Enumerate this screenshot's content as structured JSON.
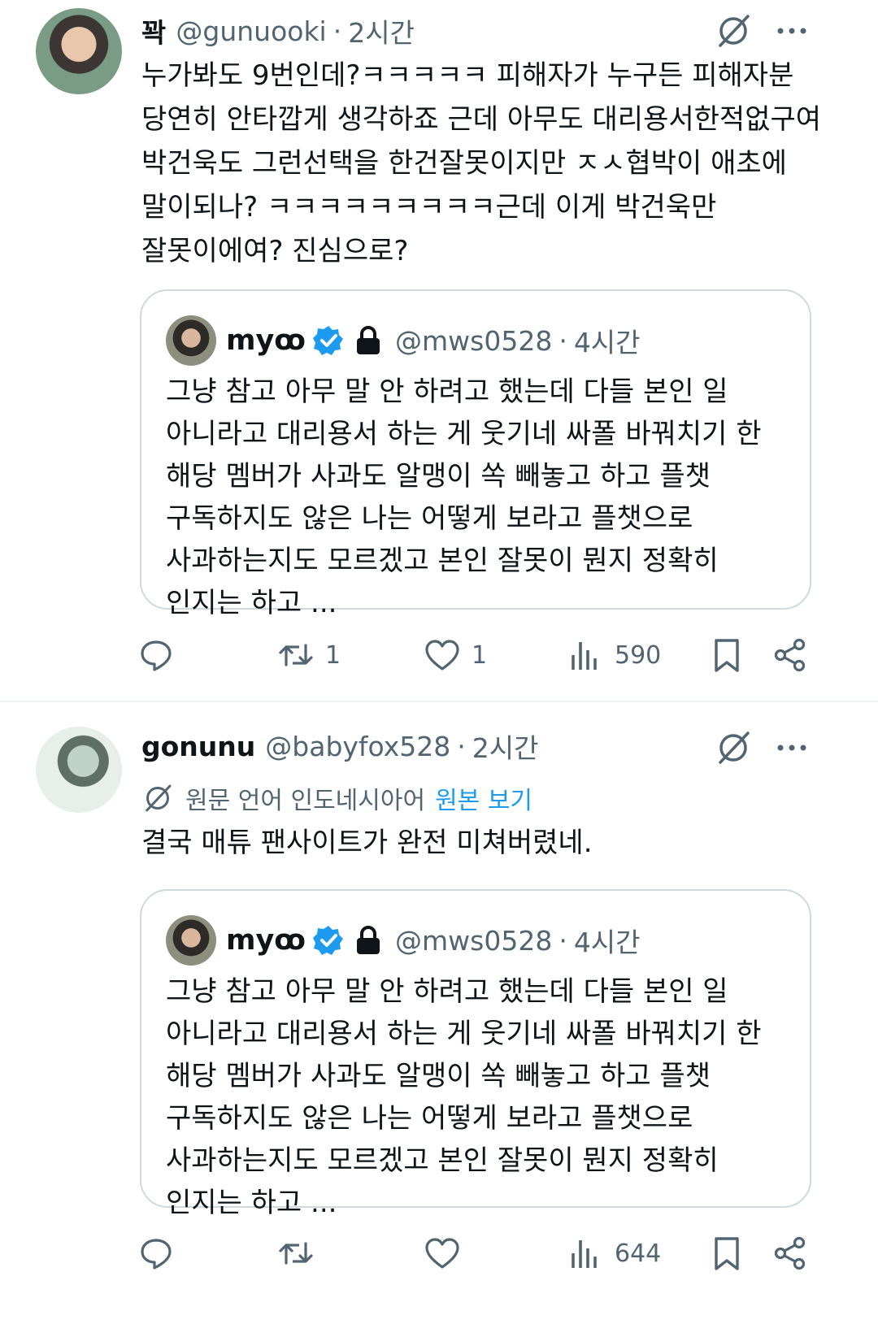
{
  "tweets": [
    {
      "display_name": "꽉",
      "handle": "@gunuooki",
      "separator": "·",
      "time": "2시간",
      "text": "누가봐도 9번인데?ㅋㅋㅋㅋㅋ 피해자가 누구든 피해자분 당연히 안타깝게 생각하죠 근데 아무도 대리용서한적없구여 박건욱도 그런선택을 한건잘못이지만 ㅈㅅ협박이 애초에 말이되나? ㅋㅋㅋㅋㅋㅋㅋㅋㅋ근데 이게 박건욱만 잘못이에여? 진심으로?",
      "quote": {
        "display_name": "myꝏ",
        "handle": "@mws0528",
        "separator": "·",
        "time": "4시간",
        "text": "그냥 참고 아무 말 안 하려고 했는데 다들 본인 일 아니라고 대리용서 하는 게 웃기네 싸폴 바꿔치기 한 해당 멤버가 사과도 알맹이 쏙 빼놓고 하고 플챗 구독하지도 않은 나는 어떻게 보라고 플챗으로 사과하는지도 모르겠고 본인 잘못이 뭔지 정확히 인지는 하고 ..."
      },
      "retweets": "1",
      "likes": "1",
      "views": "590"
    },
    {
      "display_name": "gonunu",
      "handle": "@babyfox528",
      "separator": "·",
      "time": "2시간",
      "translation_note": "원문 언어 인도네시아어",
      "translation_link": "원본 보기",
      "text": "결국 매튜 팬사이트가 완전 미쳐버렸네.",
      "quote": {
        "display_name": "myꝏ",
        "handle": "@mws0528",
        "separator": "·",
        "time": "4시간",
        "text": "그냥 참고 아무 말 안 하려고 했는데 다들 본인 일 아니라고 대리용서 하는 게 웃기네 싸폴 바꿔치기 한 해당 멤버가 사과도 알맹이 쏙 빼놓고 하고 플챗 구독하지도 않은 나는 어떻게 보라고 플챗으로 사과하는지도 모르겠고 본인 잘못이 뭔지 정확히 인지는 하고 ..."
      },
      "retweets": "",
      "likes": "",
      "views": "644"
    }
  ],
  "colors": {
    "text_primary": "#0f1419",
    "text_secondary": "#536471",
    "link": "#1d9bf0",
    "verified": "#1d9bf0",
    "border": "#cfd9de"
  },
  "icons": [
    "translate-icon",
    "more-icon",
    "verified-badge-icon",
    "lock-icon",
    "reply-icon",
    "retweet-icon",
    "like-icon",
    "views-icon",
    "bookmark-icon",
    "share-icon"
  ]
}
